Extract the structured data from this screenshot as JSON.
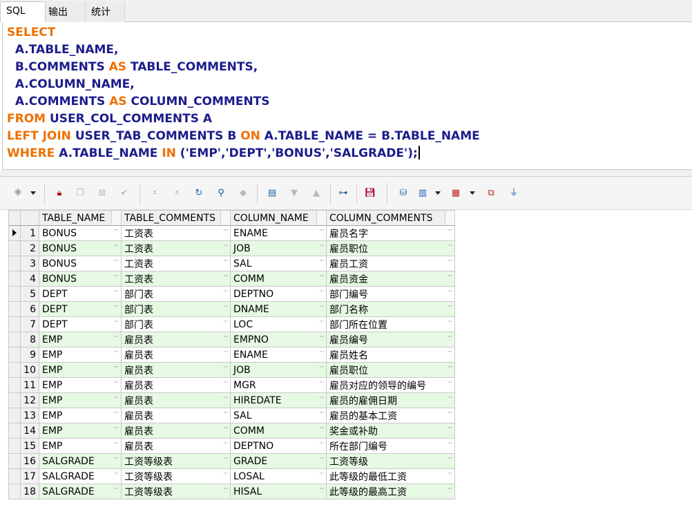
{
  "tabs": [
    {
      "label": "SQL",
      "active": true
    },
    {
      "label": "输出",
      "active": false
    },
    {
      "label": "统计",
      "active": false
    }
  ],
  "editor": {
    "lines": [
      [
        {
          "t": "SELECT",
          "c": "kw"
        }
      ],
      [
        {
          "t": "  A.TABLE_NAME,",
          "c": "id"
        }
      ],
      [
        {
          "t": "  B.COMMENTS ",
          "c": "id"
        },
        {
          "t": "AS",
          "c": "kw"
        },
        {
          "t": " TABLE_COMMENTS,",
          "c": "id"
        }
      ],
      [
        {
          "t": "  A.COLUMN_NAME,",
          "c": "id"
        }
      ],
      [
        {
          "t": "  A.COMMENTS ",
          "c": "id"
        },
        {
          "t": "AS",
          "c": "kw"
        },
        {
          "t": " COLUMN_COMMENTS",
          "c": "id"
        }
      ],
      [
        {
          "t": "FROM",
          "c": "kw"
        },
        {
          "t": " USER_COL_COMMENTS A",
          "c": "id"
        }
      ],
      [
        {
          "t": "LEFT JOIN",
          "c": "kw"
        },
        {
          "t": " USER_TAB_COMMENTS B ",
          "c": "id"
        },
        {
          "t": "ON",
          "c": "kw"
        },
        {
          "t": " A.TABLE_NAME = B.TABLE_NAME",
          "c": "id"
        }
      ],
      [
        {
          "t": "WHERE",
          "c": "kw"
        },
        {
          "t": " A.TABLE_NAME ",
          "c": "id"
        },
        {
          "t": "IN",
          "c": "kw"
        },
        {
          "t": " ('EMP','DEPT','BONUS','SALGRADE');",
          "c": "str"
        }
      ]
    ]
  },
  "toolbar": {
    "icons": [
      "select-mode-icon",
      "lock-icon",
      "new-record-icon",
      "delete-record-icon",
      "post-icon",
      "first-icon",
      "last-icon",
      "refresh-icon",
      "find-icon",
      "clear-icon",
      "export-icon",
      "prev-icon",
      "next-icon",
      "link-icon",
      "save-icon",
      "query-icon",
      "chart-icon",
      "grid-view-icon",
      "compare-icon",
      "filter-icon"
    ]
  },
  "grid": {
    "columns": [
      "TABLE_NAME",
      "TABLE_COMMENTS",
      "COLUMN_NAME",
      "COLUMN_COMMENTS"
    ],
    "current_row": 1,
    "rows": [
      {
        "n": "1",
        "cells": [
          "BONUS",
          "工资表",
          "ENAME",
          "雇员名字"
        ]
      },
      {
        "n": "2",
        "cells": [
          "BONUS",
          "工资表",
          "JOB",
          "雇员职位"
        ]
      },
      {
        "n": "3",
        "cells": [
          "BONUS",
          "工资表",
          "SAL",
          "雇员工资"
        ]
      },
      {
        "n": "4",
        "cells": [
          "BONUS",
          "工资表",
          "COMM",
          "雇员资金"
        ]
      },
      {
        "n": "5",
        "cells": [
          "DEPT",
          "部门表",
          "DEPTNO",
          "部门编号"
        ]
      },
      {
        "n": "6",
        "cells": [
          "DEPT",
          "部门表",
          "DNAME",
          "部门名称"
        ]
      },
      {
        "n": "7",
        "cells": [
          "DEPT",
          "部门表",
          "LOC",
          "部门所在位置"
        ]
      },
      {
        "n": "8",
        "cells": [
          "EMP",
          "雇员表",
          "EMPNO",
          "雇员编号"
        ]
      },
      {
        "n": "9",
        "cells": [
          "EMP",
          "雇员表",
          "ENAME",
          "雇员姓名"
        ]
      },
      {
        "n": "10",
        "cells": [
          "EMP",
          "雇员表",
          "JOB",
          "雇员职位"
        ]
      },
      {
        "n": "11",
        "cells": [
          "EMP",
          "雇员表",
          "MGR",
          "雇员对应的领导的编号"
        ]
      },
      {
        "n": "12",
        "cells": [
          "EMP",
          "雇员表",
          "HIREDATE",
          "雇员的雇佣日期"
        ]
      },
      {
        "n": "13",
        "cells": [
          "EMP",
          "雇员表",
          "SAL",
          "雇员的基本工资"
        ]
      },
      {
        "n": "14",
        "cells": [
          "EMP",
          "雇员表",
          "COMM",
          "奖金或补助"
        ]
      },
      {
        "n": "15",
        "cells": [
          "EMP",
          "雇员表",
          "DEPTNO",
          "所在部门编号"
        ]
      },
      {
        "n": "16",
        "cells": [
          "SALGRADE",
          "工资等级表",
          "GRADE",
          "工资等级"
        ]
      },
      {
        "n": "17",
        "cells": [
          "SALGRADE",
          "工资等级表",
          "LOSAL",
          "此等级的最低工资"
        ]
      },
      {
        "n": "18",
        "cells": [
          "SALGRADE",
          "工资等级表",
          "HISAL",
          "此等级的最高工资"
        ]
      }
    ]
  },
  "colors": {
    "keyword": "#f07000",
    "identifier": "#1c1c8c",
    "alt_row": "#e6f9e3"
  }
}
